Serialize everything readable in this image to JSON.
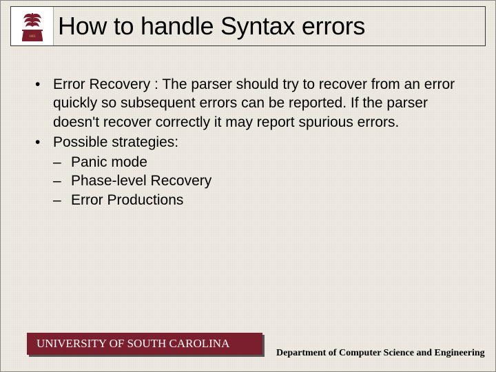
{
  "title": "How to handle Syntax errors",
  "logo": {
    "name": "usc-palmetto-logo",
    "color": "#7b1e2e",
    "year": "1801"
  },
  "bullets": [
    {
      "level": 1,
      "text": "Error Recovery : The parser should try to recover from an error quickly so subsequent errors can be reported. If the parser doesn't recover correctly it may report spurious errors."
    },
    {
      "level": 1,
      "text": "Possible strategies:"
    },
    {
      "level": 2,
      "text": "Panic mode"
    },
    {
      "level": 2,
      "text": "Phase-level Recovery"
    },
    {
      "level": 2,
      "text": "Error Productions"
    }
  ],
  "footer": {
    "university": "UNIVERSITY OF SOUTH CAROLINA",
    "department": "Department of Computer Science and Engineering"
  }
}
